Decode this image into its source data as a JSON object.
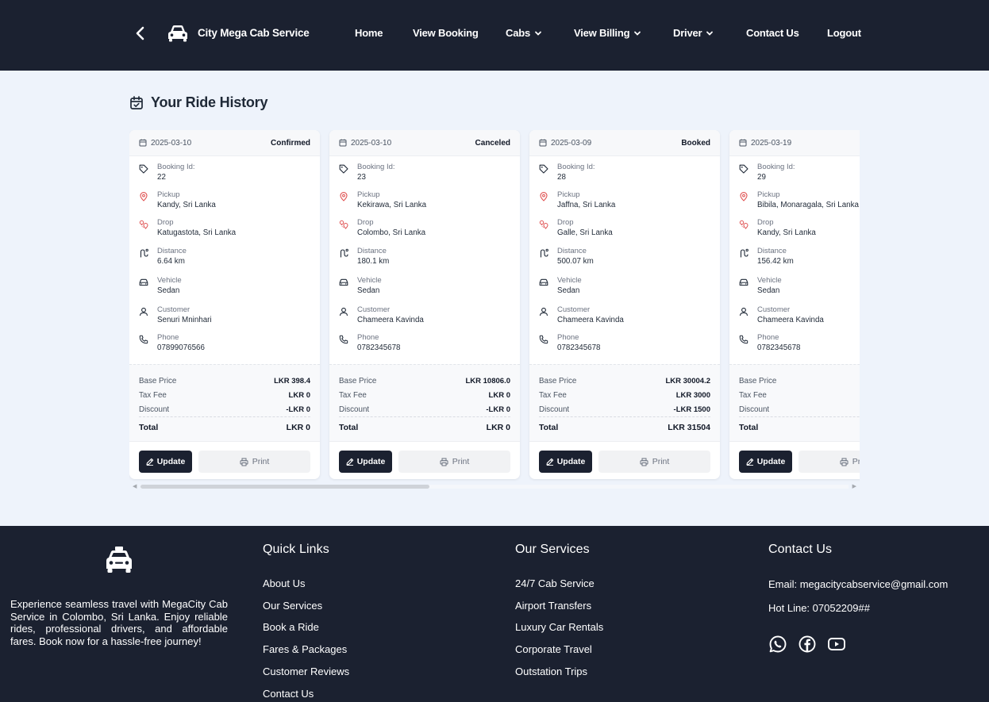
{
  "navbar": {
    "brand": "City Mega Cab Service",
    "items": [
      {
        "label": "Home"
      },
      {
        "label": "View Booking"
      },
      {
        "label": "Cabs"
      },
      {
        "label": "View Billing"
      },
      {
        "label": "Driver"
      },
      {
        "label": "Contact Us"
      },
      {
        "label": "Logout"
      }
    ]
  },
  "history": {
    "title": "Your Ride History"
  },
  "labels": {
    "booking_id": "Booking Id:",
    "pickup": "Pickup",
    "drop": "Drop",
    "distance": "Distance",
    "vehicle": "Vehicle",
    "customer": "Customer",
    "phone": "Phone",
    "base_price": "Base Price",
    "tax_fee": "Tax Fee",
    "discount": "Discount",
    "total": "Total",
    "update": "Update",
    "print": "Print"
  },
  "bookings": [
    {
      "date": "2025-03-10",
      "status": "Confirmed",
      "booking_id": "22",
      "pickup": "Kandy, Sri Lanka",
      "drop": "Katugastota, Sri Lanka",
      "distance": "6.64 km",
      "vehicle": "Sedan",
      "customer": "Senuri Mninhari",
      "phone": "07899076566",
      "base_price": "LKR 398.4",
      "tax_fee": "LKR 0",
      "discount": "-LKR 0",
      "total": "LKR 0"
    },
    {
      "date": "2025-03-10",
      "status": "Canceled",
      "booking_id": "23",
      "pickup": "Kekirawa, Sri Lanka",
      "drop": "Colombo, Sri Lanka",
      "distance": "180.1 km",
      "vehicle": "Sedan",
      "customer": "Chameera Kavinda",
      "phone": "0782345678",
      "base_price": "LKR 10806.0",
      "tax_fee": "LKR 0",
      "discount": "-LKR 0",
      "total": "LKR 0"
    },
    {
      "date": "2025-03-09",
      "status": "Booked",
      "booking_id": "28",
      "pickup": "Jaffna, Sri Lanka",
      "drop": "Galle, Sri Lanka",
      "distance": "500.07 km",
      "vehicle": "Sedan",
      "customer": "Chameera Kavinda",
      "phone": "0782345678",
      "base_price": "LKR 30004.2",
      "tax_fee": "LKR 3000",
      "discount": "-LKR 1500",
      "total": "LKR 31504"
    },
    {
      "date": "2025-03-19",
      "status": "",
      "booking_id": "29",
      "pickup": "Bibila, Monaragala, Sri Lanka",
      "drop": "Kandy, Sri Lanka",
      "distance": "156.42 km",
      "vehicle": "Sedan",
      "customer": "Chameera Kavinda",
      "phone": "0782345678",
      "base_price": "",
      "tax_fee": "",
      "discount": "",
      "total": ""
    }
  ],
  "footer": {
    "about": "Experience seamless travel with MegaCity Cab Service in Colombo, Sri Lanka. Enjoy reliable rides, professional drivers, and affordable fares. Book now for a hassle-free journey!",
    "quick_links": {
      "title": "Quick Links",
      "items": [
        "About Us",
        "Our Services",
        "Book a Ride",
        "Fares & Packages",
        "Customer Reviews",
        "Contact Us"
      ]
    },
    "services": {
      "title": "Our Services",
      "items": [
        "24/7 Cab Service",
        "Airport Transfers",
        "Luxury Car Rentals",
        "Corporate Travel",
        "Outstation Trips"
      ]
    },
    "contact": {
      "title": "Contact Us",
      "email": "Email: megacitycabservice@gmail.com",
      "hotline": "Hot Line: 07052209##"
    },
    "social_icons": [
      "whatsapp-icon",
      "facebook-icon",
      "youtube-icon"
    ]
  },
  "colors": {
    "nav_bg": "#1b2130",
    "page_bg": "#eef3fb",
    "pin_red": "#e05252"
  }
}
